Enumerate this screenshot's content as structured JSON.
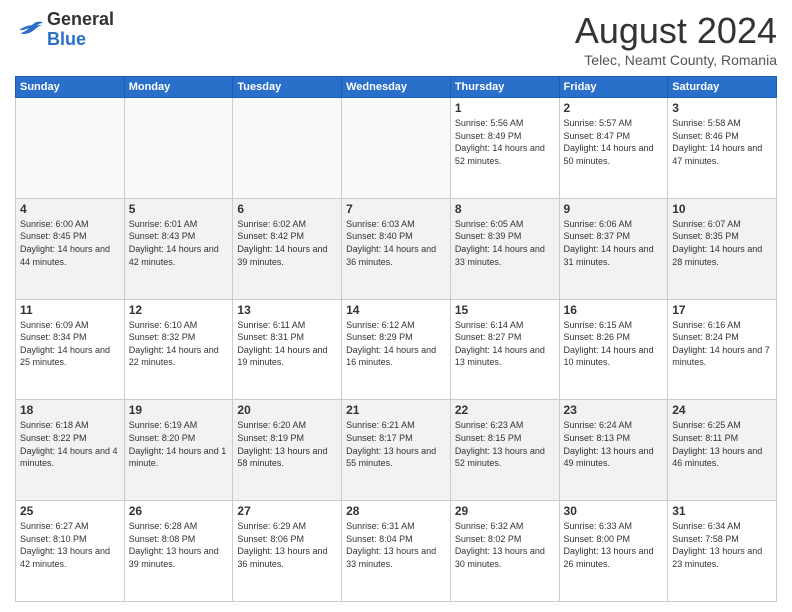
{
  "logo": {
    "line1": "General",
    "line2": "Blue"
  },
  "calendar": {
    "title": "August 2024",
    "subtitle": "Telec, Neamt County, Romania"
  },
  "headers": [
    "Sunday",
    "Monday",
    "Tuesday",
    "Wednesday",
    "Thursday",
    "Friday",
    "Saturday"
  ],
  "weeks": [
    [
      {
        "day": "",
        "info": ""
      },
      {
        "day": "",
        "info": ""
      },
      {
        "day": "",
        "info": ""
      },
      {
        "day": "",
        "info": ""
      },
      {
        "day": "1",
        "info": "Sunrise: 5:56 AM\nSunset: 8:49 PM\nDaylight: 14 hours and 52 minutes."
      },
      {
        "day": "2",
        "info": "Sunrise: 5:57 AM\nSunset: 8:47 PM\nDaylight: 14 hours and 50 minutes."
      },
      {
        "day": "3",
        "info": "Sunrise: 5:58 AM\nSunset: 8:46 PM\nDaylight: 14 hours and 47 minutes."
      }
    ],
    [
      {
        "day": "4",
        "info": "Sunrise: 6:00 AM\nSunset: 8:45 PM\nDaylight: 14 hours and 44 minutes."
      },
      {
        "day": "5",
        "info": "Sunrise: 6:01 AM\nSunset: 8:43 PM\nDaylight: 14 hours and 42 minutes."
      },
      {
        "day": "6",
        "info": "Sunrise: 6:02 AM\nSunset: 8:42 PM\nDaylight: 14 hours and 39 minutes."
      },
      {
        "day": "7",
        "info": "Sunrise: 6:03 AM\nSunset: 8:40 PM\nDaylight: 14 hours and 36 minutes."
      },
      {
        "day": "8",
        "info": "Sunrise: 6:05 AM\nSunset: 8:39 PM\nDaylight: 14 hours and 33 minutes."
      },
      {
        "day": "9",
        "info": "Sunrise: 6:06 AM\nSunset: 8:37 PM\nDaylight: 14 hours and 31 minutes."
      },
      {
        "day": "10",
        "info": "Sunrise: 6:07 AM\nSunset: 8:35 PM\nDaylight: 14 hours and 28 minutes."
      }
    ],
    [
      {
        "day": "11",
        "info": "Sunrise: 6:09 AM\nSunset: 8:34 PM\nDaylight: 14 hours and 25 minutes."
      },
      {
        "day": "12",
        "info": "Sunrise: 6:10 AM\nSunset: 8:32 PM\nDaylight: 14 hours and 22 minutes."
      },
      {
        "day": "13",
        "info": "Sunrise: 6:11 AM\nSunset: 8:31 PM\nDaylight: 14 hours and 19 minutes."
      },
      {
        "day": "14",
        "info": "Sunrise: 6:12 AM\nSunset: 8:29 PM\nDaylight: 14 hours and 16 minutes."
      },
      {
        "day": "15",
        "info": "Sunrise: 6:14 AM\nSunset: 8:27 PM\nDaylight: 14 hours and 13 minutes."
      },
      {
        "day": "16",
        "info": "Sunrise: 6:15 AM\nSunset: 8:26 PM\nDaylight: 14 hours and 10 minutes."
      },
      {
        "day": "17",
        "info": "Sunrise: 6:16 AM\nSunset: 8:24 PM\nDaylight: 14 hours and 7 minutes."
      }
    ],
    [
      {
        "day": "18",
        "info": "Sunrise: 6:18 AM\nSunset: 8:22 PM\nDaylight: 14 hours and 4 minutes."
      },
      {
        "day": "19",
        "info": "Sunrise: 6:19 AM\nSunset: 8:20 PM\nDaylight: 14 hours and 1 minute."
      },
      {
        "day": "20",
        "info": "Sunrise: 6:20 AM\nSunset: 8:19 PM\nDaylight: 13 hours and 58 minutes."
      },
      {
        "day": "21",
        "info": "Sunrise: 6:21 AM\nSunset: 8:17 PM\nDaylight: 13 hours and 55 minutes."
      },
      {
        "day": "22",
        "info": "Sunrise: 6:23 AM\nSunset: 8:15 PM\nDaylight: 13 hours and 52 minutes."
      },
      {
        "day": "23",
        "info": "Sunrise: 6:24 AM\nSunset: 8:13 PM\nDaylight: 13 hours and 49 minutes."
      },
      {
        "day": "24",
        "info": "Sunrise: 6:25 AM\nSunset: 8:11 PM\nDaylight: 13 hours and 46 minutes."
      }
    ],
    [
      {
        "day": "25",
        "info": "Sunrise: 6:27 AM\nSunset: 8:10 PM\nDaylight: 13 hours and 42 minutes."
      },
      {
        "day": "26",
        "info": "Sunrise: 6:28 AM\nSunset: 8:08 PM\nDaylight: 13 hours and 39 minutes."
      },
      {
        "day": "27",
        "info": "Sunrise: 6:29 AM\nSunset: 8:06 PM\nDaylight: 13 hours and 36 minutes."
      },
      {
        "day": "28",
        "info": "Sunrise: 6:31 AM\nSunset: 8:04 PM\nDaylight: 13 hours and 33 minutes."
      },
      {
        "day": "29",
        "info": "Sunrise: 6:32 AM\nSunset: 8:02 PM\nDaylight: 13 hours and 30 minutes."
      },
      {
        "day": "30",
        "info": "Sunrise: 6:33 AM\nSunset: 8:00 PM\nDaylight: 13 hours and 26 minutes."
      },
      {
        "day": "31",
        "info": "Sunrise: 6:34 AM\nSunset: 7:58 PM\nDaylight: 13 hours and 23 minutes."
      }
    ]
  ]
}
